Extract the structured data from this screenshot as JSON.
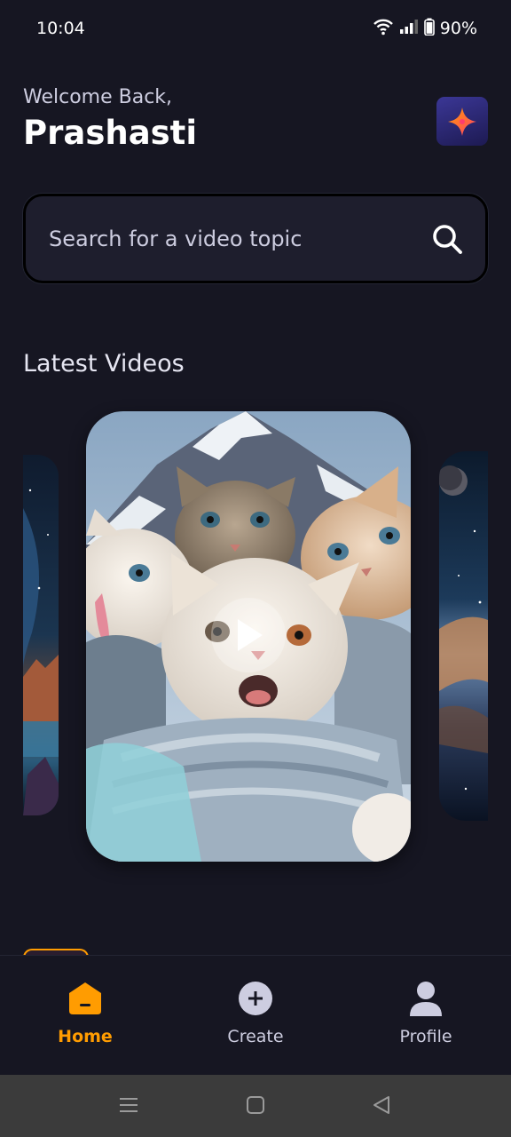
{
  "status_bar": {
    "time": "10:04",
    "battery": "90%"
  },
  "header": {
    "welcome": "Welcome Back,",
    "username": "Prashasti",
    "logo_icon": "sparkle-logo-icon"
  },
  "search": {
    "placeholder": "Search for a video topic",
    "value": "",
    "icon": "search-icon"
  },
  "latest": {
    "title": "Latest Videos",
    "videos": [
      {
        "position": "left",
        "subject": "space-landscape-thumbnail"
      },
      {
        "position": "center",
        "subject": "cats-selfie-thumbnail",
        "play_icon": "play-icon"
      },
      {
        "position": "right",
        "subject": "cosmic-thumbnail"
      }
    ]
  },
  "tabs": [
    {
      "label": "Home",
      "icon": "home-icon",
      "active": true
    },
    {
      "label": "Create",
      "icon": "plus-circle-icon",
      "active": false
    },
    {
      "label": "Profile",
      "icon": "user-icon",
      "active": false
    }
  ],
  "colors": {
    "background": "#161622",
    "accent": "#FF9C01",
    "input_bg": "#1E1E2D",
    "muted_text": "#CDCDE0",
    "system_nav": "#3B3B3B"
  }
}
